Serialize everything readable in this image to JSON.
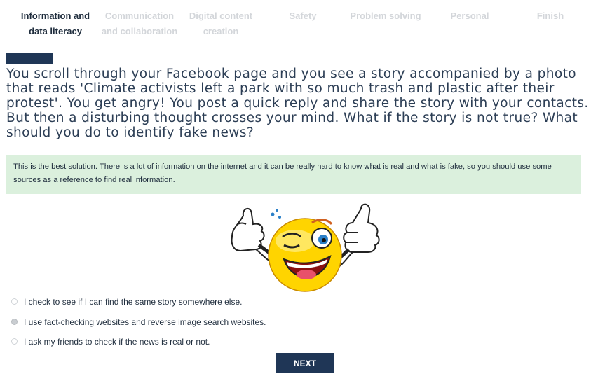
{
  "tabs": [
    {
      "line1": "Information and",
      "line2": "data literacy"
    },
    {
      "line1": "Communication",
      "line2": "and collaboration"
    },
    {
      "line1": "Digital content",
      "line2": "creation"
    },
    {
      "line1": "Safety",
      "line2": ""
    },
    {
      "line1": "Problem solving",
      "line2": ""
    },
    {
      "line1": "Personal",
      "line2": ""
    },
    {
      "line1": "Finish",
      "line2": ""
    }
  ],
  "active_tab": "Information and data literacy",
  "question": "You scroll through your Facebook page and you see a story accompanied by a photo that reads 'Climate activists left a park with so much trash and plastic after their protest'. You get angry! You post a quick reply and share the story with your contacts. But then a disturbing thought crosses your mind. What if the story is not true? What should you do to identify fake news?",
  "feedback": "This is the best solution. There is a lot of information on the internet and it can be really hard to know what is real and what is fake, so you should use some sources as a reference to find real information.",
  "illustration": "winking-thumbs-up-emoji",
  "options": [
    {
      "label": "I check to see if I can find the same story somewhere else.",
      "selected": false
    },
    {
      "label": "I use fact-checking websites and reverse image search websites.",
      "selected": true
    },
    {
      "label": "I ask my friends to check if the news is real or not.",
      "selected": false
    }
  ],
  "next_label": "NEXT",
  "colors": {
    "navy": "#1f3656",
    "feedback_bg": "#dbf0dd",
    "inactive_tab": "#d3d6da",
    "emoji_yellow": "#ffd400"
  }
}
